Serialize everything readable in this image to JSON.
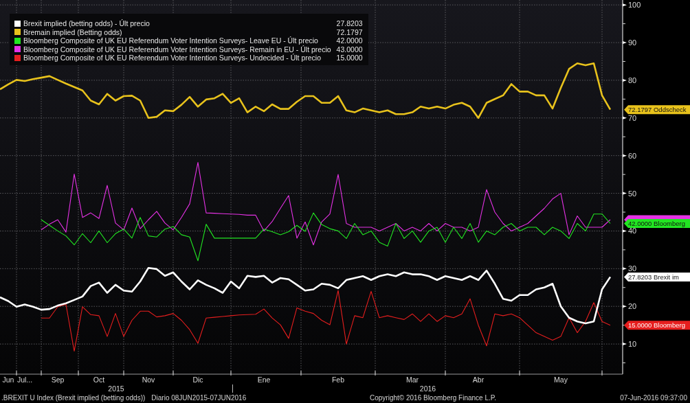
{
  "chart": {
    "chart_data": {
      "type": "line",
      "grid": true,
      "categories": [
        null,
        "Jun",
        null,
        "Jul...",
        null,
        null,
        null,
        "Sep",
        null,
        null,
        null,
        null,
        "Oct",
        null,
        null,
        null,
        null,
        null,
        "Nov",
        null,
        null,
        null,
        null,
        null,
        "Dic",
        null,
        null,
        null,
        null,
        null,
        null,
        null,
        "Ene",
        null,
        null,
        null,
        null,
        null,
        null,
        null,
        null,
        "Feb",
        null,
        null,
        null,
        null,
        null,
        null,
        null,
        null,
        "Mar",
        null,
        null,
        null,
        null,
        null,
        null,
        null,
        "Abr",
        null,
        null,
        null,
        null,
        null,
        null,
        null,
        null,
        null,
        "May",
        null,
        null,
        null,
        null,
        null,
        null
      ],
      "ylim": [
        2,
        101.3
      ],
      "yticks": [
        10,
        20,
        30,
        40,
        50,
        60,
        70,
        80,
        90,
        100
      ],
      "series": [
        {
          "name": "Brexit implied (betting odds) - Últ precio",
          "color": "#ffffff",
          "values": [
            22.4,
            21.4,
            19.9,
            20.5,
            19.9,
            19.1,
            19.3,
            20.2,
            20.8,
            21.7,
            22.6,
            25.4,
            26.3,
            23.6,
            25.7,
            24.2,
            23.9,
            26.6,
            30.2,
            29.9,
            28.1,
            29.0,
            26.6,
            24.5,
            26.9,
            25.7,
            24.8,
            23.6,
            26.6,
            24.8,
            28.1,
            27.8,
            28.1,
            26.3,
            27.5,
            27.2,
            25.7,
            24.2,
            24.5,
            26.0,
            25.7,
            24.8,
            27,
            27.5,
            28,
            27,
            28,
            28.5,
            28,
            29,
            28.5,
            28.5,
            28,
            27,
            28,
            27.5,
            27,
            28,
            27,
            29.5,
            26,
            22,
            21.5,
            23,
            23,
            24.5,
            25,
            26,
            20,
            17,
            16,
            15.5,
            16,
            24.5,
            27.8
          ]
        },
        {
          "name": "Bremain implied (Betting odds)",
          "color": "#e8c21c",
          "values": [
            77.6,
            78.9,
            80.1,
            79.8,
            80.3,
            80.7,
            81.1,
            80.1,
            79.1,
            78.2,
            77.3,
            74.6,
            73.6,
            76.4,
            74.6,
            75.8,
            75.9,
            74.6,
            70.0,
            70.3,
            72.0,
            71.8,
            73.5,
            75.6,
            73.0,
            74.9,
            75.2,
            76.4,
            74.0,
            75.2,
            71.5,
            73.0,
            71.8,
            73.6,
            72.4,
            72.4,
            74.3,
            75.8,
            75.8,
            74.0,
            74.0,
            75.8,
            72,
            71.5,
            72.5,
            72,
            71.5,
            72,
            71,
            71,
            71.5,
            73,
            72.5,
            73,
            72.5,
            73.5,
            74,
            73,
            70,
            74,
            75,
            76,
            79,
            77,
            77,
            76,
            76,
            72.5,
            78,
            83,
            84.5,
            84,
            84.5,
            76,
            72.2
          ]
        },
        {
          "name": "Bloomberg Composite of UK EU Referendum Voter Intention Surveys- Leave EU - Últ precio",
          "color": "#22e622",
          "values": [
            null,
            null,
            null,
            null,
            null,
            43.0,
            41.5,
            40.0,
            38.7,
            36.3,
            39.3,
            36.9,
            40.0,
            36.9,
            39.3,
            40.5,
            38.1,
            43.6,
            38.7,
            38.4,
            40.5,
            41.2,
            39.0,
            38.4,
            32.1,
            41.8,
            38.1,
            38.1,
            38.1,
            38.1,
            38.1,
            38.1,
            40.5,
            39.8,
            39.0,
            39.8,
            41.5,
            39.9,
            44.8,
            41.7,
            40.6,
            40.0,
            38,
            42,
            39,
            40,
            37,
            36,
            42,
            38,
            40,
            37,
            40,
            41,
            37,
            41,
            38,
            42,
            37,
            40,
            39,
            41,
            42,
            40,
            41,
            41,
            39,
            41,
            40,
            38,
            42,
            40,
            44.5,
            44.5,
            42
          ]
        },
        {
          "name": "Bloomberg Composite of UK EU Referendum Voter Intention Surveys- Remain in EU - Últ precio",
          "color": "#e632e6",
          "values": [
            null,
            null,
            null,
            null,
            null,
            40.3,
            41.8,
            43.0,
            39.7,
            55.1,
            43.6,
            44.8,
            43.3,
            52.1,
            42.1,
            40.3,
            46.1,
            40.6,
            43.0,
            45.2,
            42.1,
            40.3,
            43.6,
            47.2,
            58.2,
            44.8,
            44.7,
            44.6,
            44.5,
            44.4,
            44.2,
            44.2,
            40.0,
            42.5,
            46.0,
            49.4,
            38.1,
            42.4,
            36.3,
            42.4,
            44.5,
            55,
            42,
            41,
            41,
            41,
            40,
            41,
            42,
            40,
            41,
            40,
            42,
            40,
            42,
            41,
            41,
            40,
            41,
            51,
            45,
            42,
            40,
            41,
            42,
            44,
            46,
            48.5,
            50,
            39,
            44,
            41,
            41,
            41,
            43
          ]
        },
        {
          "name": "Bloomberg Composite of UK EU Referendum Voter Intention Surveys- Undecided - Últ precio",
          "color": "#e61e1e",
          "values": [
            null,
            null,
            null,
            null,
            null,
            16.9,
            16.9,
            19.9,
            20.5,
            8.1,
            19.9,
            17.8,
            17.5,
            12.0,
            18.1,
            12.0,
            16.3,
            18.7,
            18.7,
            17.2,
            17.5,
            18.1,
            16.3,
            13.8,
            10.2,
            16.9,
            17.1,
            17.3,
            17.5,
            17.7,
            17.8,
            17.9,
            19.3,
            16.9,
            15.1,
            11.5,
            19.6,
            18.7,
            18.1,
            16.3,
            15.1,
            24.2,
            10,
            17.5,
            17,
            24,
            17,
            17.5,
            17,
            16.5,
            18,
            16,
            18,
            16,
            17.5,
            17,
            18,
            22,
            15,
            9.5,
            18,
            17.5,
            18,
            17,
            15,
            13,
            12,
            11,
            12,
            17,
            13,
            16,
            21,
            16,
            15
          ]
        }
      ]
    },
    "legend": [
      {
        "value": "27.8203",
        "kind": "odds"
      },
      {
        "value": "72.1797",
        "kind": "odds"
      },
      {
        "value": "42.0000",
        "kind": "survey"
      },
      {
        "value": "43.0000",
        "kind": "survey"
      },
      {
        "value": "15.0000",
        "kind": "survey"
      }
    ],
    "value_tags": [
      {
        "label": "72.1797 Oddscheck",
        "color": "#e8c21c"
      },
      {
        "color": "#e632e6"
      },
      {
        "label": "42.0000 Bloomberg",
        "color": "#22e622"
      },
      {
        "label": "27.8203 Brexit im",
        "color": "#ffffff"
      },
      {
        "label": "15.0000 Bloomberg",
        "color": "#e61e1e"
      }
    ],
    "years": [
      "2015",
      "2016"
    ]
  },
  "footer": {
    "index_title": ".BREXIT U Index (Brexit implied (betting odds))",
    "period": "Diario 08JUN2015-07JUN2016",
    "copyright": "Copyright© 2016 Bloomberg Finance L.P.",
    "timestamp": "07-Jun-2016 09:37:00"
  }
}
